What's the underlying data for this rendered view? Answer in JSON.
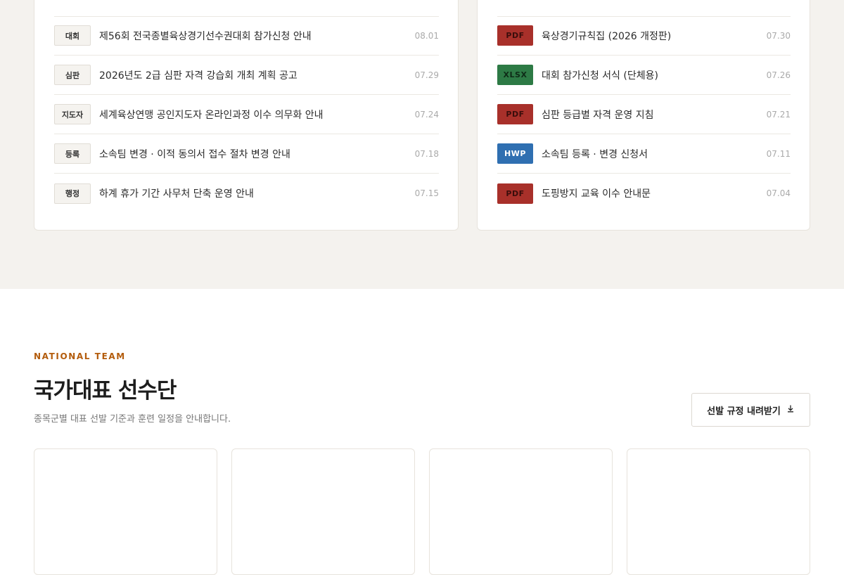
{
  "notices": {
    "items": [
      {
        "category": "대회",
        "title": "제56회 전국종별육상경기선수권대회 참가신청 안내",
        "date": "08.01"
      },
      {
        "category": "심판",
        "title": "2026년도 2급 심판 자격 강습회 개최 계획 공고",
        "date": "07.29"
      },
      {
        "category": "지도자",
        "title": "세계육상연맹 공인지도자 온라인과정 이수 의무화 안내",
        "date": "07.24"
      },
      {
        "category": "등록",
        "title": "소속팀 변경 · 이적 동의서 접수 절차 변경 안내",
        "date": "07.18"
      },
      {
        "category": "행정",
        "title": "하계 휴가 기간 사무처 단축 운영 안내",
        "date": "07.15"
      }
    ]
  },
  "downloads": {
    "items": [
      {
        "type": "PDF",
        "title": "육상경기규칙집 (2026 개정판)",
        "date": "07.30"
      },
      {
        "type": "XLSX",
        "title": "대회 참가신청 서식 (단체용)",
        "date": "07.26"
      },
      {
        "type": "PDF",
        "title": "심판 등급별 자격 운영 지침",
        "date": "07.21"
      },
      {
        "type": "HWP",
        "title": "소속팀 등록 · 변경 신청서",
        "date": "07.11"
      },
      {
        "type": "PDF",
        "title": "도핑방지 교육 이수 안내문",
        "date": "07.04"
      }
    ]
  },
  "national_team": {
    "eyebrow": "NATIONAL TEAM",
    "title": "국가대표 선수단",
    "subtitle": "종목군별 대표 선발 기준과 훈련 일정을 안내합니다.",
    "download_button": "선발 규정 내려받기"
  },
  "colors": {
    "background_band": "#f4f2ee",
    "accent": "#b35c0c",
    "pdf": "#a8302a",
    "xlsx": "#2d7a45",
    "hwp": "#2f6fb1"
  }
}
